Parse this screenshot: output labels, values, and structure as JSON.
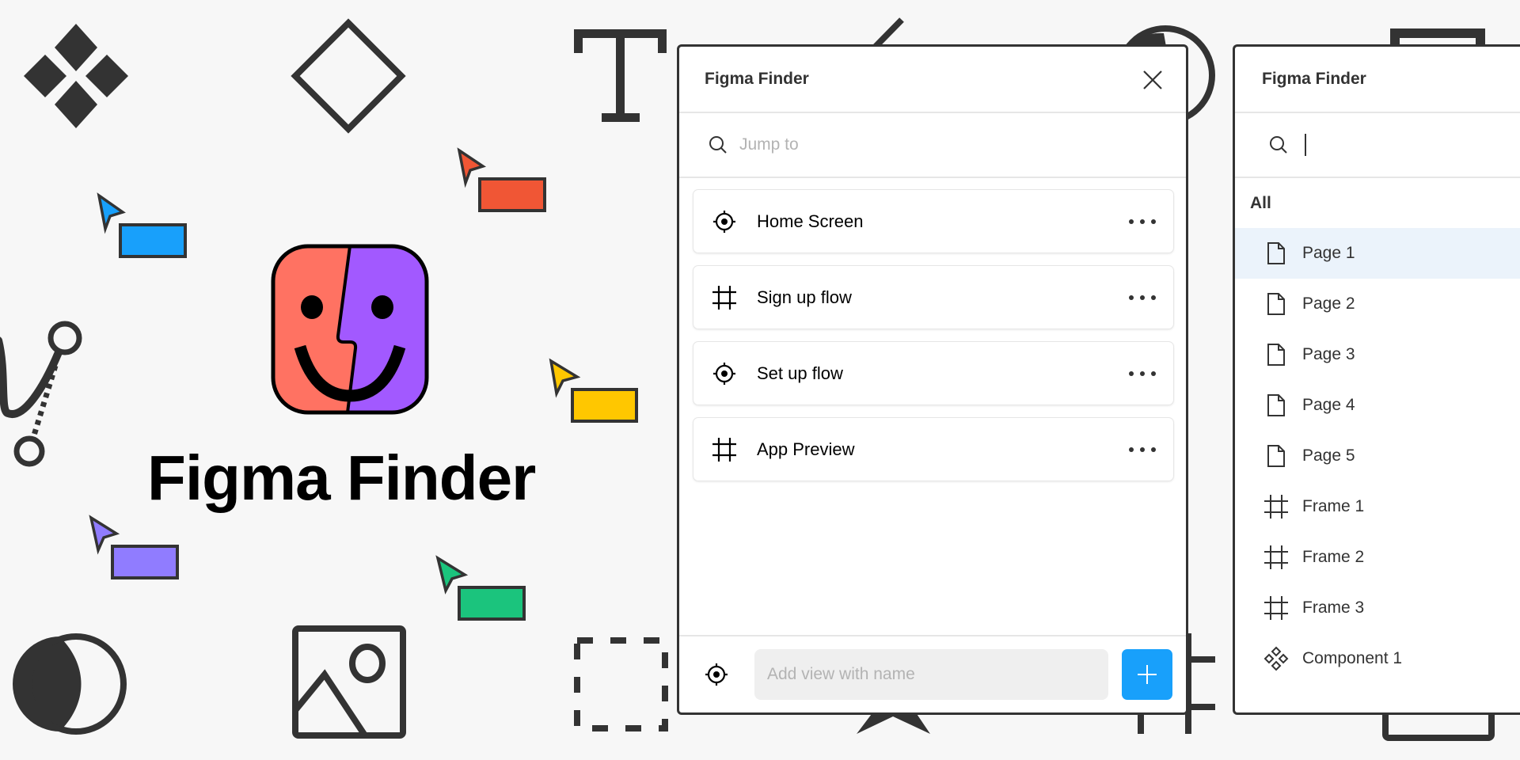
{
  "hero": {
    "title": "Figma Finder",
    "logo_colors": {
      "left": "#ff7262",
      "right": "#a259ff"
    }
  },
  "decorations": {
    "cursors": [
      {
        "name": "blue",
        "color": "#18a0fb"
      },
      {
        "name": "red",
        "color": "#f05635"
      },
      {
        "name": "yellow",
        "color": "#ffc700"
      },
      {
        "name": "purple",
        "color": "#907cff"
      },
      {
        "name": "green",
        "color": "#1bc47d"
      }
    ],
    "tool_icons": [
      "components-icon",
      "diamond-icon",
      "text-tool-icon",
      "pen-tool-icon",
      "moon-icon",
      "image-icon",
      "dashed-selection-icon",
      "ellipse-icon",
      "line-icon",
      "star-icon",
      "frame-icon",
      "rectangle-icon"
    ]
  },
  "panel_main": {
    "title": "Figma Finder",
    "close_icon": "close-icon",
    "search": {
      "placeholder": "Jump to",
      "value": "",
      "icon": "search-icon"
    },
    "views": [
      {
        "label": "Home Screen",
        "icon": "target-icon"
      },
      {
        "label": "Sign up flow",
        "icon": "frame-icon"
      },
      {
        "label": "Set up flow",
        "icon": "target-icon"
      },
      {
        "label": "App Preview",
        "icon": "frame-icon"
      }
    ],
    "footer": {
      "icon": "target-icon",
      "input_placeholder": "Add view with name",
      "input_value": "",
      "add_button_icon": "plus-icon",
      "accent": "#18a0fb"
    }
  },
  "panel_jump": {
    "title": "Figma Finder",
    "search": {
      "placeholder": "",
      "value": "",
      "icon": "search-icon"
    },
    "section_label": "All",
    "items": [
      {
        "label": "Page 1",
        "type": "page",
        "selected": true
      },
      {
        "label": "Page 2",
        "type": "page"
      },
      {
        "label": "Page 3",
        "type": "page"
      },
      {
        "label": "Page 4",
        "type": "page"
      },
      {
        "label": "Page 5",
        "type": "page"
      },
      {
        "label": "Frame 1",
        "type": "frame"
      },
      {
        "label": "Frame 2",
        "type": "frame"
      },
      {
        "label": "Frame 3",
        "type": "frame"
      },
      {
        "label": "Component 1",
        "type": "component"
      }
    ],
    "selected_color": "#ebf3fb"
  }
}
